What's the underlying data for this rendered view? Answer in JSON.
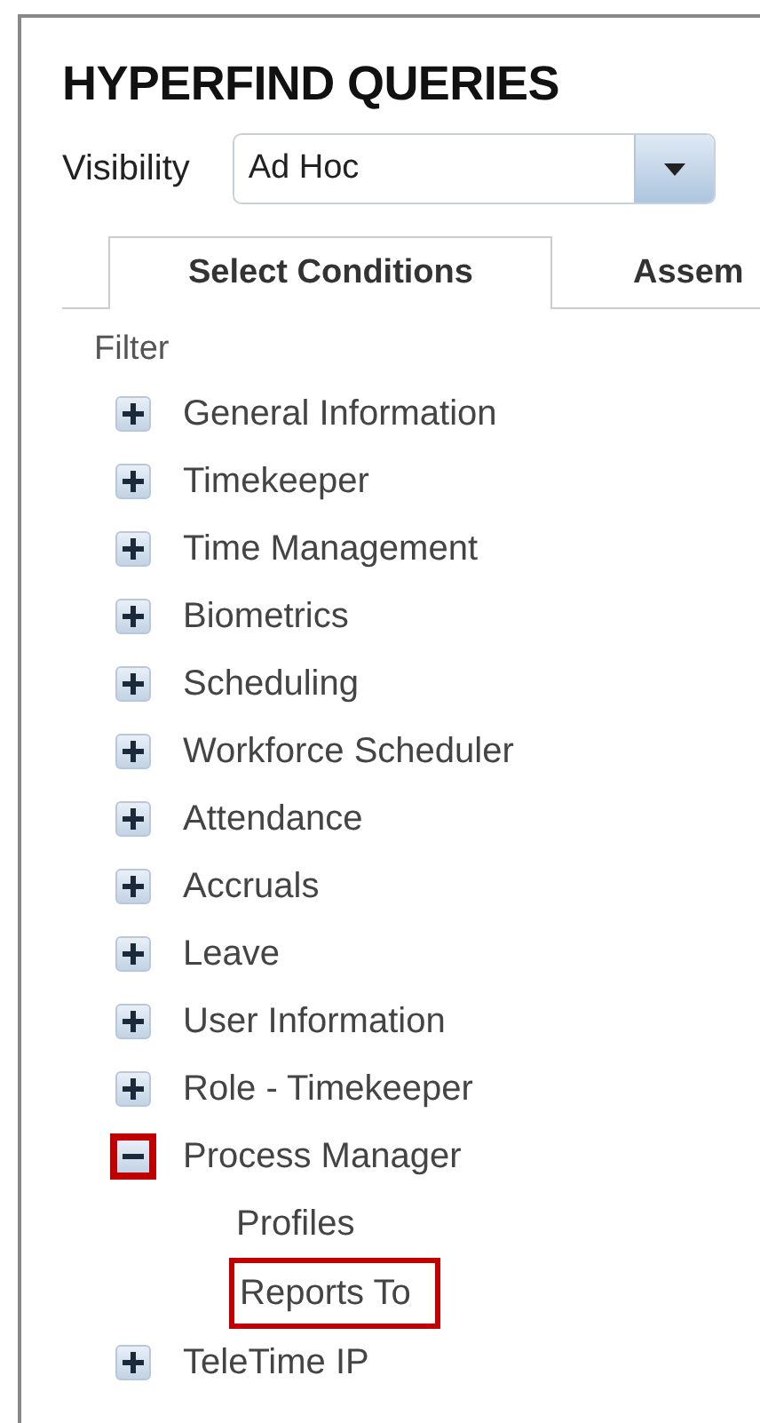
{
  "title": "HYPERFIND QUERIES",
  "visibility": {
    "label": "Visibility",
    "value": "Ad Hoc"
  },
  "tabs": [
    {
      "label": "Select Conditions",
      "selected": true
    },
    {
      "label": "Assem",
      "selected": false
    }
  ],
  "filter_label": "Filter",
  "tree": [
    {
      "label": "General Information",
      "expanded": false,
      "highlighted": false
    },
    {
      "label": "Timekeeper",
      "expanded": false,
      "highlighted": false
    },
    {
      "label": "Time Management",
      "expanded": false,
      "highlighted": false
    },
    {
      "label": "Biometrics",
      "expanded": false,
      "highlighted": false
    },
    {
      "label": "Scheduling",
      "expanded": false,
      "highlighted": false
    },
    {
      "label": "Workforce Scheduler",
      "expanded": false,
      "highlighted": false
    },
    {
      "label": "Attendance",
      "expanded": false,
      "highlighted": false
    },
    {
      "label": "Accruals",
      "expanded": false,
      "highlighted": false
    },
    {
      "label": "Leave",
      "expanded": false,
      "highlighted": false
    },
    {
      "label": "User Information",
      "expanded": false,
      "highlighted": false
    },
    {
      "label": "Role - Timekeeper",
      "expanded": false,
      "highlighted": false
    },
    {
      "label": "Process Manager",
      "expanded": true,
      "highlighted": true,
      "children": [
        {
          "label": "Profiles",
          "highlighted": false
        },
        {
          "label": "Reports To",
          "highlighted": true
        }
      ]
    },
    {
      "label": "TeleTime IP",
      "expanded": false,
      "highlighted": false
    }
  ]
}
